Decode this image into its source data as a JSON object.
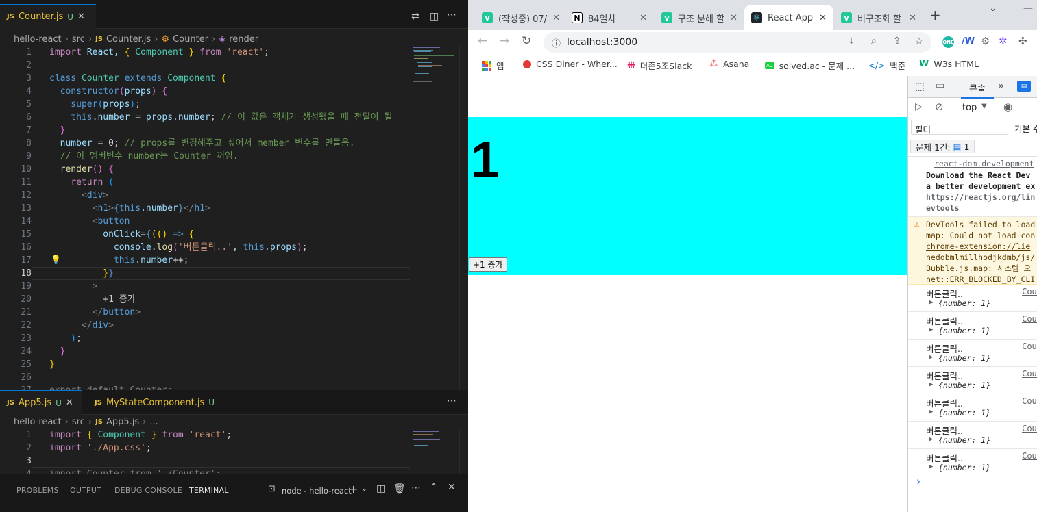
{
  "vscode": {
    "top_editor": {
      "tab": {
        "badge": "JS",
        "name": "Counter.js",
        "status": "U"
      },
      "breadcrumb": [
        "hello-react",
        "src",
        "Counter.js",
        "Counter",
        "render"
      ],
      "lines": [
        {
          "n": "1",
          "tokens": [
            [
              "import",
              "kw"
            ],
            [
              " React, ",
              "v"
            ],
            [
              "{",
              "b1"
            ],
            [
              " Component ",
              "t"
            ],
            [
              "}",
              "b1"
            ],
            [
              " from ",
              "kw"
            ],
            [
              "'react'",
              "s"
            ],
            [
              ";",
              "x"
            ]
          ]
        },
        {
          "n": "2",
          "tokens": []
        },
        {
          "n": "3",
          "tokens": [
            [
              "class",
              "k"
            ],
            [
              " Counter ",
              "t"
            ],
            [
              "extends",
              "k"
            ],
            [
              " Component ",
              "t"
            ],
            [
              "{",
              "b1"
            ]
          ]
        },
        {
          "n": "4",
          "tokens": [
            [
              "  constructor",
              "k"
            ],
            [
              "(",
              "b2"
            ],
            [
              "props",
              "v"
            ],
            [
              ")",
              "b2"
            ],
            [
              " {",
              "b2"
            ]
          ]
        },
        {
          "n": "5",
          "tokens": [
            [
              "    super",
              "k"
            ],
            [
              "(",
              "b3"
            ],
            [
              "props",
              "v"
            ],
            [
              ")",
              "b3"
            ],
            [
              ";",
              "x"
            ]
          ]
        },
        {
          "n": "6",
          "tokens": [
            [
              "    this",
              "k"
            ],
            [
              ".",
              "x"
            ],
            [
              "number",
              "v"
            ],
            [
              " = ",
              "x"
            ],
            [
              "props",
              "v"
            ],
            [
              ".",
              "x"
            ],
            [
              "number",
              "v"
            ],
            [
              "; ",
              "x"
            ],
            [
              "// 이 값은 객체가 생성됐을 때 전달이 될",
              "c"
            ]
          ]
        },
        {
          "n": "7",
          "tokens": [
            [
              "  }",
              "b2"
            ]
          ]
        },
        {
          "n": "8",
          "tokens": [
            [
              "  number",
              "v"
            ],
            [
              " = ",
              "x"
            ],
            [
              "0",
              "x"
            ],
            [
              "; ",
              "x"
            ],
            [
              "// props를 변경해주고 싶어서 member 변수를 만들음.",
              "c"
            ]
          ]
        },
        {
          "n": "9",
          "tokens": [
            [
              "  // 이 멤버변수 number는 Counter 꺼임.",
              "c"
            ]
          ]
        },
        {
          "n": "10",
          "tokens": [
            [
              "  render",
              "f"
            ],
            [
              "()",
              "b2"
            ],
            [
              " {",
              "b2"
            ]
          ]
        },
        {
          "n": "11",
          "tokens": [
            [
              "    return",
              "kw"
            ],
            [
              " (",
              "b3"
            ]
          ]
        },
        {
          "n": "12",
          "tokens": [
            [
              "      <",
              "p"
            ],
            [
              "div",
              "k"
            ],
            [
              ">",
              "p"
            ]
          ]
        },
        {
          "n": "13",
          "tokens": [
            [
              "        <",
              "p"
            ],
            [
              "h1",
              "k"
            ],
            [
              ">",
              "p"
            ],
            [
              "{",
              "k"
            ],
            [
              "this",
              "k"
            ],
            [
              ".",
              "x"
            ],
            [
              "number",
              "v"
            ],
            [
              "}",
              "k"
            ],
            [
              "</",
              "p"
            ],
            [
              "h1",
              "k"
            ],
            [
              ">",
              "p"
            ]
          ]
        },
        {
          "n": "14",
          "tokens": [
            [
              "        <",
              "p"
            ],
            [
              "button",
              "k"
            ]
          ]
        },
        {
          "n": "15",
          "tokens": [
            [
              "          onClick",
              "v"
            ],
            [
              "=",
              "x"
            ],
            [
              "{",
              "k"
            ],
            [
              "(",
              "b1"
            ],
            [
              "() ",
              "b1"
            ],
            [
              "=>",
              "k"
            ],
            [
              " {",
              "b1"
            ]
          ]
        },
        {
          "n": "16",
          "tokens": [
            [
              "            console",
              "v"
            ],
            [
              ".",
              "x"
            ],
            [
              "log",
              "f"
            ],
            [
              "(",
              "b2"
            ],
            [
              "'버튼클릭..'",
              "s"
            ],
            [
              ", ",
              "x"
            ],
            [
              "this",
              "k"
            ],
            [
              ".",
              "x"
            ],
            [
              "props",
              "v"
            ],
            [
              ")",
              "b2"
            ],
            [
              ";",
              "x"
            ]
          ]
        },
        {
          "n": "17",
          "tokens": [
            [
              "            this",
              "k"
            ],
            [
              ".",
              "x"
            ],
            [
              "number",
              "v"
            ],
            [
              "++;",
              "x"
            ]
          ]
        },
        {
          "n": "18",
          "tokens": [
            [
              "          ",
              "x"
            ],
            [
              "}",
              "b1"
            ],
            [
              "}",
              "k"
            ]
          ]
        },
        {
          "n": "19",
          "tokens": [
            [
              "        >",
              "p"
            ]
          ]
        },
        {
          "n": "20",
          "tokens": [
            [
              "          +1 증가",
              "x"
            ]
          ]
        },
        {
          "n": "21",
          "tokens": [
            [
              "        </",
              "p"
            ],
            [
              "button",
              "k"
            ],
            [
              ">",
              "p"
            ]
          ]
        },
        {
          "n": "22",
          "tokens": [
            [
              "      </",
              "p"
            ],
            [
              "div",
              "k"
            ],
            [
              ">",
              "p"
            ]
          ]
        },
        {
          "n": "23",
          "tokens": [
            [
              "    )",
              "b3"
            ],
            [
              ";",
              "x"
            ]
          ]
        },
        {
          "n": "24",
          "tokens": [
            [
              "  }",
              "b2"
            ]
          ]
        },
        {
          "n": "25",
          "tokens": [
            [
              "}",
              "b1"
            ]
          ]
        },
        {
          "n": "26",
          "tokens": []
        },
        {
          "n": "27",
          "tokens": [
            [
              "export default Counter;",
              "p"
            ]
          ]
        }
      ],
      "current_line": "18"
    },
    "bottom_editor": {
      "tabs": [
        {
          "badge": "JS",
          "name": "App5.js",
          "status": "U",
          "active": true
        },
        {
          "badge": "JS",
          "name": "MyStateComponent.js",
          "status": "U",
          "active": false
        }
      ],
      "breadcrumb": [
        "hello-react",
        "src",
        "App5.js",
        "..."
      ],
      "lines": [
        {
          "n": "1",
          "tokens": [
            [
              "import",
              "kw"
            ],
            [
              " ",
              "x"
            ],
            [
              "{",
              "b1"
            ],
            [
              " Component ",
              "t"
            ],
            [
              "}",
              "b1"
            ],
            [
              " from ",
              "kw"
            ],
            [
              "'react'",
              "s"
            ],
            [
              ";",
              "x"
            ]
          ]
        },
        {
          "n": "2",
          "tokens": [
            [
              "import",
              "kw"
            ],
            [
              " ",
              "x"
            ],
            [
              "'./App.css'",
              "s"
            ],
            [
              ";",
              "x"
            ]
          ]
        },
        {
          "n": "3",
          "tokens": []
        },
        {
          "n": "4",
          "tokens": [
            [
              "import Counter from './Counter';",
              "p"
            ]
          ]
        }
      ],
      "current_line": "3"
    },
    "panel": {
      "tabs": [
        "PROBLEMS",
        "OUTPUT",
        "DEBUG CONSOLE",
        "TERMINAL"
      ],
      "active_tab": "TERMINAL",
      "terminal_name": "node - hello-react"
    }
  },
  "chrome": {
    "tabs": [
      {
        "label": "(작성중) 07/",
        "icon": "velog-icon",
        "color": "#20c997",
        "glyph": "v",
        "active": false
      },
      {
        "label": "84일차",
        "icon": "notion-icon",
        "color": "#000000",
        "glyph": "N",
        "active": false
      },
      {
        "label": "구조 분해 할",
        "icon": "velog-icon",
        "color": "#20c997",
        "glyph": "v",
        "active": false
      },
      {
        "label": "React App",
        "icon": "react-icon",
        "color": "#20232a",
        "glyph": "⚛",
        "active": true
      },
      {
        "label": "비구조화 할",
        "icon": "velog-icon",
        "color": "#20c997",
        "glyph": "v",
        "active": false
      }
    ],
    "new_tab": "+",
    "url": "localhost:3000",
    "bookmarks": [
      {
        "label": "앱",
        "icon": "apps-grid-icon",
        "color": "#ea4335"
      },
      {
        "label": "CSS Diner - Wher...",
        "icon": "css-diner-icon",
        "color": "#e53935"
      },
      {
        "label": "더존5조Slack",
        "icon": "slack-icon",
        "color": "#e01e5a"
      },
      {
        "label": "Asana",
        "icon": "asana-icon",
        "color": "#f06a6a"
      },
      {
        "label": "solved.ac - 문제 ...",
        "icon": "solvedac-icon",
        "color": "#17ce3a"
      },
      {
        "label": "백준",
        "icon": "baekjoon-icon",
        "color": "#0076c0"
      },
      {
        "label": "W3s HTML",
        "icon": "w3schools-icon",
        "color": "#04aa6d"
      }
    ],
    "page": {
      "heading": "1",
      "button_label": "+1 증가",
      "background": "#00ffff"
    },
    "devtools": {
      "tab_console": "콘솔",
      "context": "top",
      "filter_placeholder": "필터",
      "levels": "기본 수",
      "issues_label": "문제 1건:",
      "issues_count": "1",
      "messages": [
        {
          "type": "info",
          "source": "react-dom.development",
          "lines": [
            "Download the React Dev",
            "a better development ex",
            "https://reactjs.org/lin",
            "evtools"
          ]
        },
        {
          "type": "warning",
          "lines": [
            "DevTools failed to load",
            "map: Could not load con",
            "chrome-extension://lie",
            "nedobmlmillhodjkdmb/js/",
            "Bubble.js.map: 시스템 오",
            "net::ERR_BLOCKED_BY_CLI"
          ]
        }
      ],
      "logs": [
        {
          "text": "버튼클릭..",
          "source": "Cour",
          "object": "{number: 1}"
        },
        {
          "text": "버튼클릭..",
          "source": "Cour",
          "object": "{number: 1}"
        },
        {
          "text": "버튼클릭..",
          "source": "Cour",
          "object": "{number: 1}"
        },
        {
          "text": "버튼클릭..",
          "source": "Cour",
          "object": "{number: 1}"
        },
        {
          "text": "버튼클릭..",
          "source": "Cour",
          "object": "{number: 1}"
        },
        {
          "text": "버튼클릭..",
          "source": "Cour",
          "object": "{number: 1}"
        },
        {
          "text": "버튼클릭..",
          "source": "Cour",
          "object": "{number: 1}"
        }
      ],
      "prompt": "›"
    }
  }
}
